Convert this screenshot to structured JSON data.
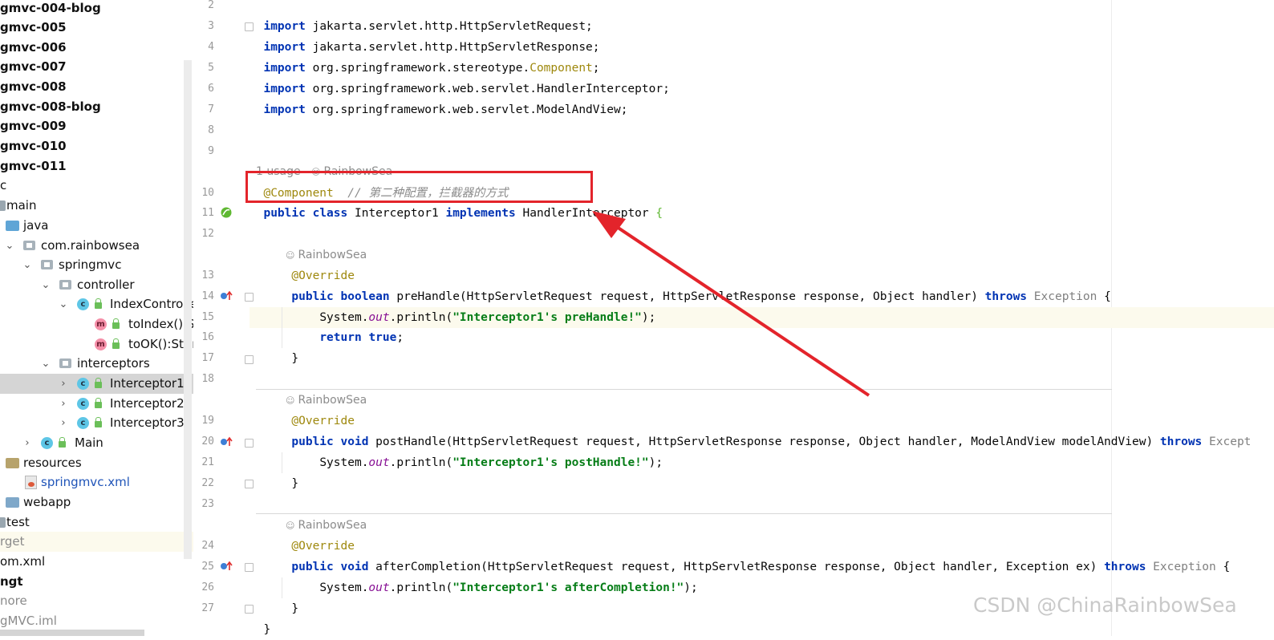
{
  "project_tree": {
    "items": [
      {
        "label": "gmvc-004-blog"
      },
      {
        "label": "gmvc-005"
      },
      {
        "label": "gmvc-006"
      },
      {
        "label": "gmvc-007"
      },
      {
        "label": "gmvc-008"
      },
      {
        "label": "gmvc-008-blog"
      },
      {
        "label": "gmvc-009"
      },
      {
        "label": "gmvc-010"
      },
      {
        "label": "gmvc-011"
      },
      {
        "label": "c"
      },
      {
        "label": "main"
      },
      {
        "label": "java"
      },
      {
        "label": "com.rainbowsea"
      },
      {
        "label": "springmvc"
      },
      {
        "label": "controller"
      },
      {
        "label": "IndexController"
      },
      {
        "label": "toIndex():St"
      },
      {
        "label": "toOK():Strin"
      },
      {
        "label": "interceptors"
      },
      {
        "label": "Interceptor1"
      },
      {
        "label": "Interceptor2"
      },
      {
        "label": "Interceptor3"
      },
      {
        "label": "Main"
      },
      {
        "label": "resources"
      },
      {
        "label": "springmvc.xml"
      },
      {
        "label": "webapp"
      },
      {
        "label": "test"
      },
      {
        "label": "rget"
      },
      {
        "label": "om.xml"
      },
      {
        "label": "ngt"
      },
      {
        "label": "nore"
      },
      {
        "label": "gMVC.iml"
      }
    ]
  },
  "editor": {
    "line_numbers": [
      "2",
      "3",
      "4",
      "5",
      "6",
      "7",
      "8",
      "9",
      "10",
      "11",
      "12",
      "13",
      "14",
      "15",
      "16",
      "17",
      "18",
      "19",
      "20",
      "21",
      "22",
      "23",
      "24",
      "25",
      "26",
      "27"
    ],
    "imports": [
      {
        "kw": "import",
        "path": " jakarta.servlet.http.HttpServletRequest;",
        "tail": ""
      },
      {
        "kw": "import",
        "path": " jakarta.servlet.http.HttpServletResponse;",
        "tail": ""
      },
      {
        "kw": "import",
        "path": " org.springframework.stereotype.",
        "tail": "Component",
        "end": ";"
      },
      {
        "kw": "import",
        "path": " org.springframework.web.servlet.HandlerInterceptor;",
        "tail": ""
      },
      {
        "kw": "import",
        "path": " org.springframework.web.servlet.ModelAndView;",
        "tail": ""
      }
    ],
    "class_hint": {
      "usage": "1 usage",
      "author": "RainbowSea"
    },
    "annotation_line": {
      "annotation": "@Component",
      "comment": "// 第二种配置，拦截器的方式"
    },
    "class_decl": {
      "kw1": "public",
      "kw2": "class",
      "name": " Interceptor1 ",
      "kw3": "implements",
      "iface": " HandlerInterceptor ",
      "brace": "{"
    },
    "method_author": "RainbowSea",
    "override": "@Override",
    "pre": {
      "sig_kw1": "public",
      "sig_kw2": "boolean",
      "sig": " preHandle(HttpServletRequest request, HttpServletResponse response, Object handler) ",
      "throws": "throws",
      "exc": " Exception ",
      "brace": "{",
      "body_a": "System.",
      "body_out": "out",
      "body_b": ".println(",
      "body_str": "\"Interceptor1's preHandle!\"",
      "body_c": ");",
      "ret_kw": "return",
      "ret_val": "true",
      "ret_end": ";",
      "close": "}"
    },
    "post": {
      "sig_kw1": "public",
      "sig_kw2": "void",
      "sig": " postHandle(HttpServletRequest request, HttpServletResponse response, Object handler, ModelAndView modelAndView) ",
      "throws": "throws",
      "exc": " Except",
      "body_a": "System.",
      "body_out": "out",
      "body_b": ".println(",
      "body_str": "\"Interceptor1's postHandle!\"",
      "body_c": ");",
      "close": "}"
    },
    "after": {
      "sig_kw1": "public",
      "sig_kw2": "void",
      "sig": " afterCompletion(HttpServletRequest request, HttpServletResponse response, Object handler, Exception ex) ",
      "throws": "throws",
      "exc": " Exception ",
      "brace": "{",
      "body_a": "System.",
      "body_out": "out",
      "body_b": ".println(",
      "body_str": "\"Interceptor1's afterCompletion!\"",
      "body_c": ");",
      "close": "}"
    },
    "last_line": "}"
  },
  "watermark": "CSDN @ChinaRainbowSea",
  "colors": {
    "highlight_box": "#e3242b",
    "arrow": "#e3242b",
    "keyword": "#0033b3",
    "string": "#067d17",
    "annotation": "#9e880d"
  }
}
